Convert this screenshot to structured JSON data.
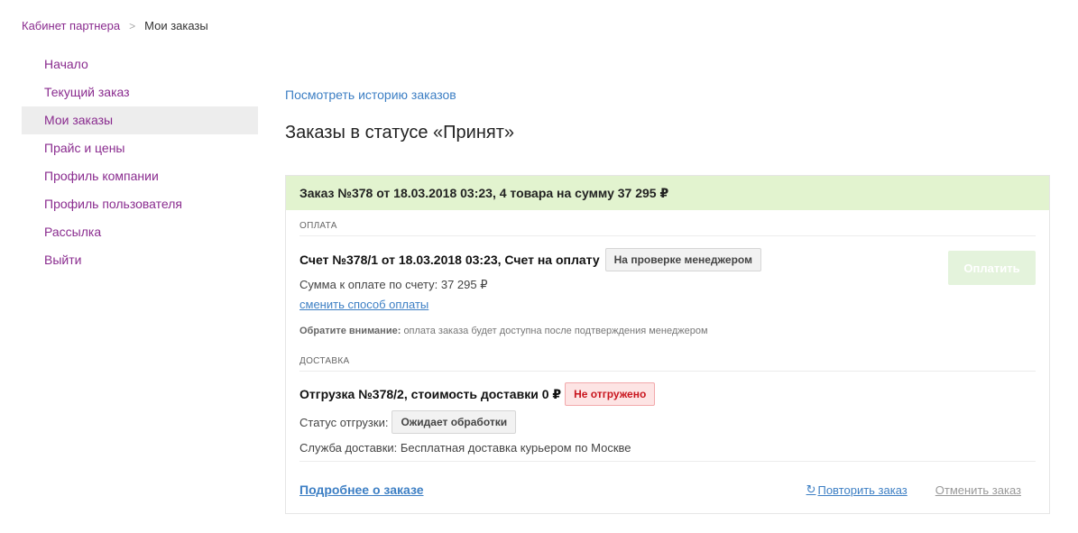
{
  "breadcrumb": {
    "root": "Кабинет партнера",
    "separator": ">",
    "current": "Мои заказы"
  },
  "sidebar": {
    "items": [
      {
        "label": "Начало"
      },
      {
        "label": "Текущий заказ"
      },
      {
        "label": "Мои заказы",
        "active": true
      },
      {
        "label": "Прайс и цены"
      },
      {
        "label": "Профиль компании"
      },
      {
        "label": "Профиль пользователя"
      },
      {
        "label": "Рассылка"
      },
      {
        "label": "Выйти"
      }
    ]
  },
  "main": {
    "history_link": "Посмотреть историю заказов",
    "title": "Заказы в статусе «Принят»"
  },
  "order": {
    "header": "Заказ №378 от 18.03.2018 03:23, 4 товара на сумму 37 295 ₽",
    "payment": {
      "section_label": "ОПЛАТА",
      "invoice_title": "Счет №378/1 от 18.03.2018 03:23, Счет на оплату",
      "invoice_status": "На проверке менеджером",
      "amount_text": "Сумма к оплате по счету: 37 295 ₽",
      "change_method_link": "сменить способ оплаты",
      "note_label": "Обратите внимание:",
      "note_text": "оплата заказа будет доступна после подтверждения менеджером",
      "pay_button": "Оплатить"
    },
    "delivery": {
      "section_label": "ДОСТАВКА",
      "shipment_title": "Отгрузка №378/2, стоимость доставки 0 ₽",
      "shipment_badge": "Не отгружено",
      "status_label": "Статус отгрузки:",
      "status_value": "Ожидает обработки",
      "service_text": "Служба доставки: Бесплатная доставка курьером по Москве"
    },
    "footer": {
      "details_link": "Подробнее о заказе",
      "repeat_icon": "refresh-icon",
      "repeat_link": "Повторить заказ",
      "cancel_link": "Отменить заказ"
    }
  },
  "colors": {
    "accent_purple": "#8a2c8f",
    "link_blue": "#3d7fc4",
    "order_header_bg": "#e2f3cf",
    "pay_button_bg": "#e4f3dc",
    "badge_red": "#c9151e"
  }
}
